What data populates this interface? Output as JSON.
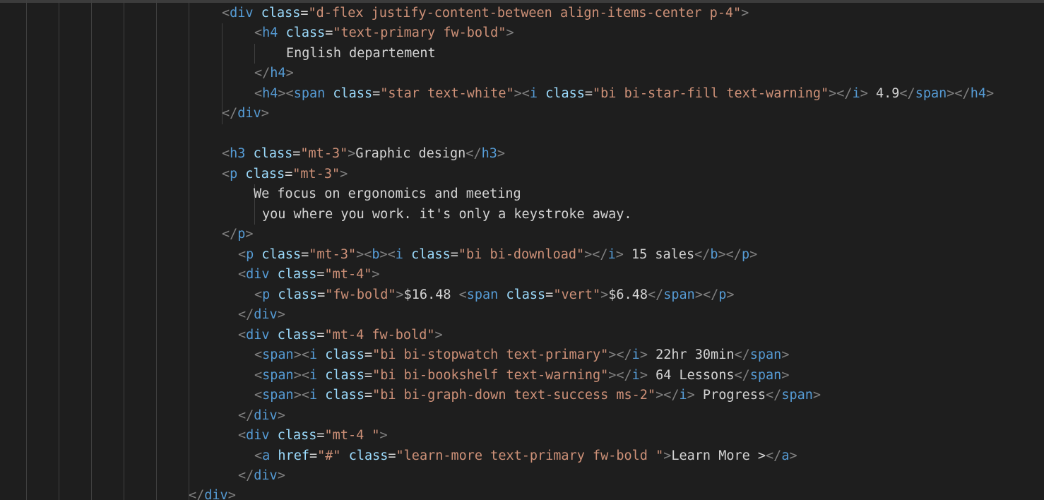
{
  "editor": {
    "colors": {
      "background": "#1e1e1e",
      "tag": "#569cd6",
      "bracket": "#808080",
      "attribute": "#9cdcfe",
      "string": "#ce9178",
      "text": "#d4d4d4"
    },
    "lines": [
      [
        [
          "br",
          "<"
        ],
        [
          "tag",
          "div"
        ],
        [
          "txt",
          " "
        ],
        [
          "attr",
          "class"
        ],
        [
          "txt",
          "="
        ],
        [
          "str",
          "\"d-flex justify-content-between align-items-center p-4\""
        ],
        [
          "br",
          ">"
        ]
      ],
      [
        [
          "br",
          "<"
        ],
        [
          "tag",
          "h4"
        ],
        [
          "txt",
          " "
        ],
        [
          "attr",
          "class"
        ],
        [
          "txt",
          "="
        ],
        [
          "str",
          "\"text-primary fw-bold\""
        ],
        [
          "br",
          ">"
        ]
      ],
      [
        [
          "txt",
          "English departement"
        ]
      ],
      [
        [
          "br",
          "</"
        ],
        [
          "tag",
          "h4"
        ],
        [
          "br",
          ">"
        ]
      ],
      [
        [
          "br",
          "<"
        ],
        [
          "tag",
          "h4"
        ],
        [
          "br",
          "><"
        ],
        [
          "tag",
          "span"
        ],
        [
          "txt",
          " "
        ],
        [
          "attr",
          "class"
        ],
        [
          "txt",
          "="
        ],
        [
          "str",
          "\"star text-white\""
        ],
        [
          "br",
          "><"
        ],
        [
          "tag",
          "i"
        ],
        [
          "txt",
          " "
        ],
        [
          "attr",
          "class"
        ],
        [
          "txt",
          "="
        ],
        [
          "str",
          "\"bi bi-star-fill text-warning\""
        ],
        [
          "br",
          "></"
        ],
        [
          "tag",
          "i"
        ],
        [
          "br",
          ">"
        ],
        [
          "txt",
          " 4.9"
        ],
        [
          "br",
          "</"
        ],
        [
          "tag",
          "span"
        ],
        [
          "br",
          "></"
        ],
        [
          "tag",
          "h4"
        ],
        [
          "br",
          ">"
        ]
      ],
      [
        [
          "br",
          "</"
        ],
        [
          "tag",
          "div"
        ],
        [
          "br",
          ">"
        ]
      ],
      [],
      [
        [
          "br",
          "<"
        ],
        [
          "tag",
          "h3"
        ],
        [
          "txt",
          " "
        ],
        [
          "attr",
          "class"
        ],
        [
          "txt",
          "="
        ],
        [
          "str",
          "\"mt-3\""
        ],
        [
          "br",
          ">"
        ],
        [
          "txt",
          "Graphic design"
        ],
        [
          "br",
          "</"
        ],
        [
          "tag",
          "h3"
        ],
        [
          "br",
          ">"
        ]
      ],
      [
        [
          "br",
          "<"
        ],
        [
          "tag",
          "p"
        ],
        [
          "txt",
          " "
        ],
        [
          "attr",
          "class"
        ],
        [
          "txt",
          "="
        ],
        [
          "str",
          "\"mt-3\""
        ],
        [
          "br",
          ">"
        ]
      ],
      [
        [
          "txt",
          "We focus on ergonomics and meeting"
        ]
      ],
      [
        [
          "txt",
          "you where you work. it's only a keystroke away."
        ]
      ],
      [
        [
          "br",
          "</"
        ],
        [
          "tag",
          "p"
        ],
        [
          "br",
          ">"
        ]
      ],
      [
        [
          "br",
          "<"
        ],
        [
          "tag",
          "p"
        ],
        [
          "txt",
          " "
        ],
        [
          "attr",
          "class"
        ],
        [
          "txt",
          "="
        ],
        [
          "str",
          "\"mt-3\""
        ],
        [
          "br",
          "><"
        ],
        [
          "tag",
          "b"
        ],
        [
          "br",
          "><"
        ],
        [
          "tag",
          "i"
        ],
        [
          "txt",
          " "
        ],
        [
          "attr",
          "class"
        ],
        [
          "txt",
          "="
        ],
        [
          "str",
          "\"bi bi-download\""
        ],
        [
          "br",
          "></"
        ],
        [
          "tag",
          "i"
        ],
        [
          "br",
          ">"
        ],
        [
          "txt",
          " 15 sales"
        ],
        [
          "br",
          "</"
        ],
        [
          "tag",
          "b"
        ],
        [
          "br",
          "></"
        ],
        [
          "tag",
          "p"
        ],
        [
          "br",
          ">"
        ]
      ],
      [
        [
          "br",
          "<"
        ],
        [
          "tag",
          "div"
        ],
        [
          "txt",
          " "
        ],
        [
          "attr",
          "class"
        ],
        [
          "txt",
          "="
        ],
        [
          "str",
          "\"mt-4\""
        ],
        [
          "br",
          ">"
        ]
      ],
      [
        [
          "br",
          "<"
        ],
        [
          "tag",
          "p"
        ],
        [
          "txt",
          " "
        ],
        [
          "attr",
          "class"
        ],
        [
          "txt",
          "="
        ],
        [
          "str",
          "\"fw-bold\""
        ],
        [
          "br",
          ">"
        ],
        [
          "txt",
          "$16.48 "
        ],
        [
          "br",
          "<"
        ],
        [
          "tag",
          "span"
        ],
        [
          "txt",
          " "
        ],
        [
          "attr",
          "class"
        ],
        [
          "txt",
          "="
        ],
        [
          "str",
          "\"vert\""
        ],
        [
          "br",
          ">"
        ],
        [
          "txt",
          "$6.48"
        ],
        [
          "br",
          "</"
        ],
        [
          "tag",
          "span"
        ],
        [
          "br",
          "></"
        ],
        [
          "tag",
          "p"
        ],
        [
          "br",
          ">"
        ]
      ],
      [
        [
          "br",
          "</"
        ],
        [
          "tag",
          "div"
        ],
        [
          "br",
          ">"
        ]
      ],
      [
        [
          "br",
          "<"
        ],
        [
          "tag",
          "div"
        ],
        [
          "txt",
          " "
        ],
        [
          "attr",
          "class"
        ],
        [
          "txt",
          "="
        ],
        [
          "str",
          "\"mt-4 fw-bold\""
        ],
        [
          "br",
          ">"
        ]
      ],
      [
        [
          "br",
          "<"
        ],
        [
          "tag",
          "span"
        ],
        [
          "br",
          "><"
        ],
        [
          "tag",
          "i"
        ],
        [
          "txt",
          " "
        ],
        [
          "attr",
          "class"
        ],
        [
          "txt",
          "="
        ],
        [
          "str",
          "\"bi bi-stopwatch text-primary\""
        ],
        [
          "br",
          "></"
        ],
        [
          "tag",
          "i"
        ],
        [
          "br",
          ">"
        ],
        [
          "txt",
          " 22hr 30min"
        ],
        [
          "br",
          "</"
        ],
        [
          "tag",
          "span"
        ],
        [
          "br",
          ">"
        ]
      ],
      [
        [
          "br",
          "<"
        ],
        [
          "tag",
          "span"
        ],
        [
          "br",
          "><"
        ],
        [
          "tag",
          "i"
        ],
        [
          "txt",
          " "
        ],
        [
          "attr",
          "class"
        ],
        [
          "txt",
          "="
        ],
        [
          "str",
          "\"bi bi-bookshelf text-warning\""
        ],
        [
          "br",
          "></"
        ],
        [
          "tag",
          "i"
        ],
        [
          "br",
          ">"
        ],
        [
          "txt",
          " 64 Lessons"
        ],
        [
          "br",
          "</"
        ],
        [
          "tag",
          "span"
        ],
        [
          "br",
          ">"
        ]
      ],
      [
        [
          "br",
          "<"
        ],
        [
          "tag",
          "span"
        ],
        [
          "br",
          "><"
        ],
        [
          "tag",
          "i"
        ],
        [
          "txt",
          " "
        ],
        [
          "attr",
          "class"
        ],
        [
          "txt",
          "="
        ],
        [
          "str",
          "\"bi bi-graph-down text-success ms-2\""
        ],
        [
          "br",
          "></"
        ],
        [
          "tag",
          "i"
        ],
        [
          "br",
          ">"
        ],
        [
          "txt",
          " Progress"
        ],
        [
          "br",
          "</"
        ],
        [
          "tag",
          "span"
        ],
        [
          "br",
          ">"
        ]
      ],
      [
        [
          "br",
          "</"
        ],
        [
          "tag",
          "div"
        ],
        [
          "br",
          ">"
        ]
      ],
      [
        [
          "br",
          "<"
        ],
        [
          "tag",
          "div"
        ],
        [
          "txt",
          " "
        ],
        [
          "attr",
          "class"
        ],
        [
          "txt",
          "="
        ],
        [
          "str",
          "\"mt-4 \""
        ],
        [
          "br",
          ">"
        ]
      ],
      [
        [
          "br",
          "<"
        ],
        [
          "tag",
          "a"
        ],
        [
          "txt",
          " "
        ],
        [
          "attr",
          "href"
        ],
        [
          "txt",
          "="
        ],
        [
          "str",
          "\"#\""
        ],
        [
          "txt",
          " "
        ],
        [
          "attr",
          "class"
        ],
        [
          "txt",
          "="
        ],
        [
          "str",
          "\"learn-more text-primary fw-bold \""
        ],
        [
          "br",
          ">"
        ],
        [
          "txt",
          "Learn More >"
        ],
        [
          "br",
          "</"
        ],
        [
          "tag",
          "a"
        ],
        [
          "br",
          ">"
        ]
      ],
      [
        [
          "br",
          "</"
        ],
        [
          "tag",
          "div"
        ],
        [
          "br",
          ">"
        ]
      ],
      [
        [
          "br",
          "</"
        ],
        [
          "tag",
          "div"
        ],
        [
          "br",
          ">"
        ]
      ]
    ]
  }
}
